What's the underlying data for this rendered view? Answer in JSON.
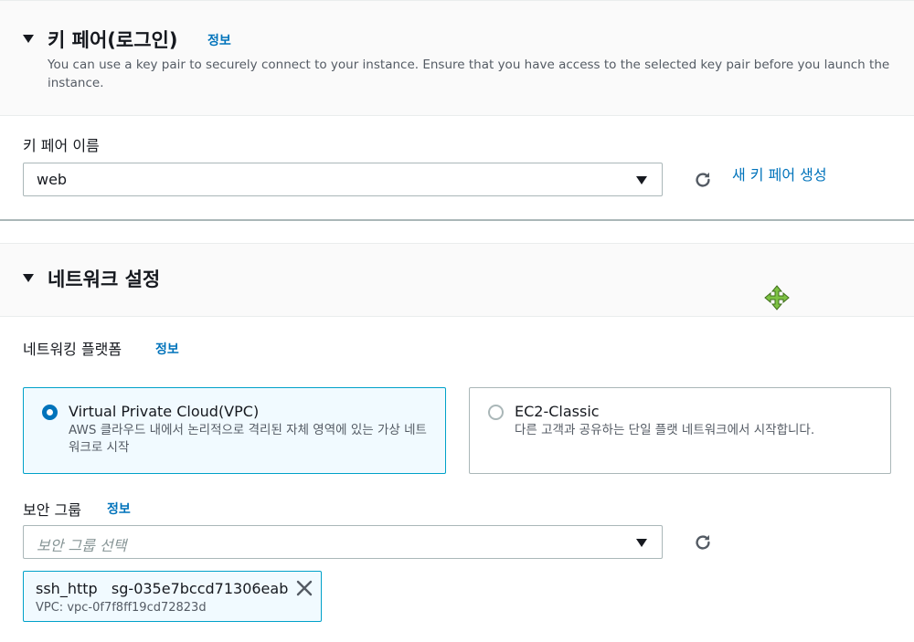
{
  "keypair": {
    "title": "키 페어(로그인)",
    "info": "정보",
    "description": "You can use a key pair to securely connect to your instance. Ensure that you have access to the selected key pair before you launch the instance.",
    "name_label": "키 페어 이름",
    "selected_value": "web",
    "create_link": "새 키 페어 생성"
  },
  "network": {
    "title": "네트워크 설정",
    "platform_label": "네트워킹 플랫폼",
    "platform_info": "정보",
    "options": [
      {
        "title": "Virtual Private Cloud(VPC)",
        "desc": "AWS 클라우드 내에서 논리적으로 격리된 자체 영역에 있는 가상 네트워크로 시작",
        "selected": true
      },
      {
        "title": "EC2-Classic",
        "desc": "다른 고객과 공유하는 단일 플랫 네트워크에서 시작합니다.",
        "selected": false
      }
    ],
    "sg_label": "보안 그룹",
    "sg_info": "정보",
    "sg_placeholder": "보안 그룹 선택",
    "token": {
      "name": "ssh_http",
      "id": "sg-035e7bccd71306eab",
      "vpc": "VPC: vpc-0f7f8ff19cd72823d"
    }
  },
  "colors": {
    "accent": "#0073bb",
    "selected_border": "#00a1c9",
    "move_cursor": "#7dc243"
  },
  "icons": [
    "caret-down-icon",
    "refresh-icon",
    "dropdown-icon",
    "radio-icon",
    "close-icon",
    "move-cursor-icon"
  ]
}
